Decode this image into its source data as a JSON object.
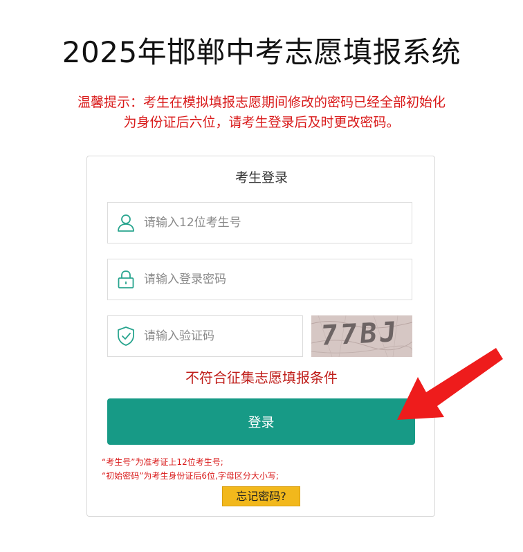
{
  "header": {
    "title": "2025年邯郸中考志愿填报系统"
  },
  "notice": {
    "line1": "温馨提示：考生在模拟填报志愿期间修改的密码已经全部初始化",
    "line2": "为身份证后六位，请考生登录后及时更改密码。"
  },
  "login": {
    "title": "考生登录",
    "student_id_placeholder": "请输入12位考生号",
    "password_placeholder": "请输入登录密码",
    "captcha_placeholder": "请输入验证码",
    "captcha_text": "77BJ",
    "ineligible_link": "不符合征集志愿填报条件",
    "submit_label": "登录",
    "hint1": "“考生号”为准考证上12位考生号;",
    "hint2": "“初始密码”为考生身份证后6位,字母区分大小写;",
    "forgot_label": "忘记密码?"
  },
  "colors": {
    "accent": "#179a86",
    "notice_red": "#d91a1a",
    "forgot_yellow": "#f2b81c",
    "arrow_red": "#ee1c1c"
  },
  "icons": {
    "student_id": "user-icon",
    "password": "lock-icon",
    "captcha": "shield-check-icon",
    "annotation": "red-arrow-icon"
  }
}
